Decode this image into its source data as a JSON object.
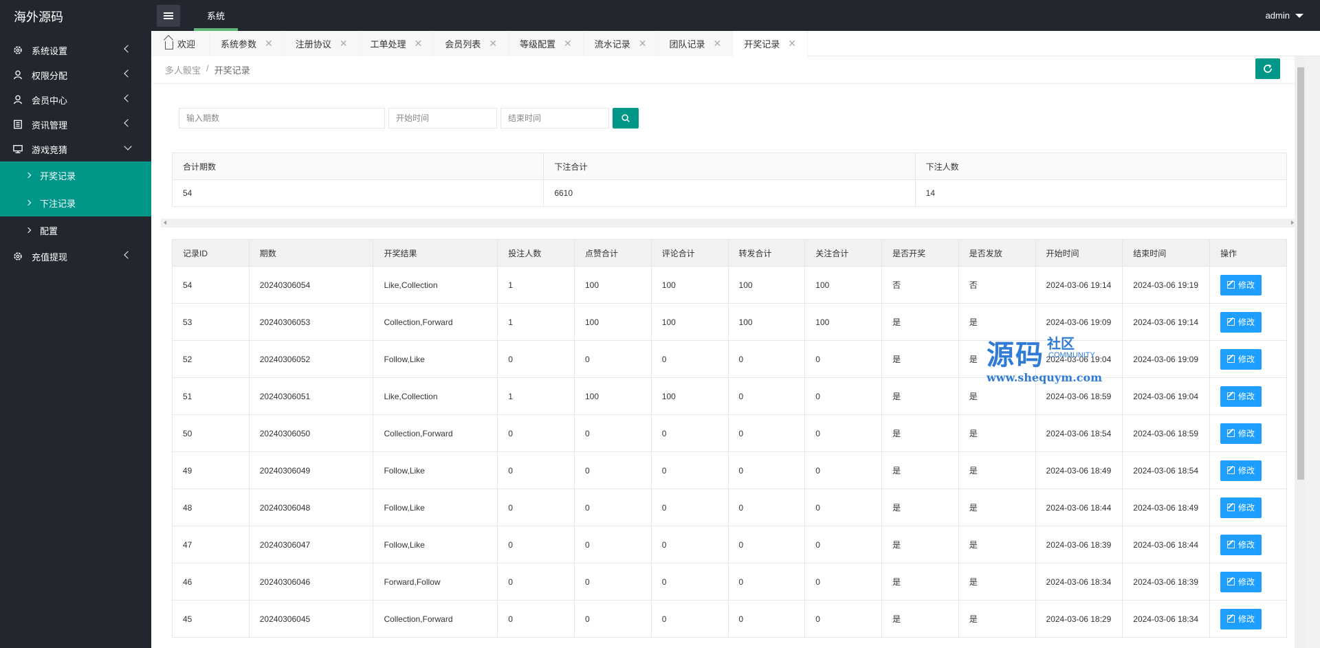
{
  "app": {
    "logo": "海外源码",
    "user": "admin"
  },
  "top_nav": {
    "label": "系统"
  },
  "sidebar": {
    "items": [
      {
        "label": "系统设置",
        "icon": "gear-icon"
      },
      {
        "label": "权限分配",
        "icon": "user-icon"
      },
      {
        "label": "会员中心",
        "icon": "user-icon"
      },
      {
        "label": "资讯管理",
        "icon": "document-icon"
      },
      {
        "label": "游戏竞猜",
        "icon": "monitor-icon"
      },
      {
        "label": "充值提现",
        "icon": "gear-icon"
      }
    ],
    "sub_items": [
      "开奖记录",
      "下注记录",
      "配置"
    ]
  },
  "tabs": [
    "欢迎",
    "系统参数",
    "注册协议",
    "工单处理",
    "会员列表",
    "等级配置",
    "流水记录",
    "团队记录",
    "开奖记录"
  ],
  "breadcrumb": {
    "root": "多人骰宝",
    "sep": "/",
    "current": "开奖记录"
  },
  "search": {
    "period_placeholder": "输入期数",
    "start_placeholder": "开始时间",
    "end_placeholder": "结束时间"
  },
  "summary": {
    "headers": [
      "合计期数",
      "下注合计",
      "下注人数"
    ],
    "values": [
      "54",
      "6610",
      "14"
    ]
  },
  "records": {
    "headers": [
      "记录ID",
      "期数",
      "开奖结果",
      "投注人数",
      "点赞合计",
      "评论合计",
      "转发合计",
      "关注合计",
      "是否开奖",
      "是否发放",
      "开始时间",
      "结束时间",
      "操作"
    ],
    "edit_label": "修改",
    "rows": [
      [
        "54",
        "20240306054",
        "Like,Collection",
        "1",
        "100",
        "100",
        "100",
        "100",
        "否",
        "否",
        "2024-03-06 19:14",
        "2024-03-06 19:19"
      ],
      [
        "53",
        "20240306053",
        "Collection,Forward",
        "1",
        "100",
        "100",
        "100",
        "100",
        "是",
        "是",
        "2024-03-06 19:09",
        "2024-03-06 19:14"
      ],
      [
        "52",
        "20240306052",
        "Follow,Like",
        "0",
        "0",
        "0",
        "0",
        "0",
        "是",
        "是",
        "2024-03-06 19:04",
        "2024-03-06 19:09"
      ],
      [
        "51",
        "20240306051",
        "Like,Collection",
        "1",
        "100",
        "100",
        "0",
        "0",
        "是",
        "是",
        "2024-03-06 18:59",
        "2024-03-06 19:04"
      ],
      [
        "50",
        "20240306050",
        "Collection,Forward",
        "0",
        "0",
        "0",
        "0",
        "0",
        "是",
        "是",
        "2024-03-06 18:54",
        "2024-03-06 18:59"
      ],
      [
        "49",
        "20240306049",
        "Follow,Like",
        "0",
        "0",
        "0",
        "0",
        "0",
        "是",
        "是",
        "2024-03-06 18:49",
        "2024-03-06 18:54"
      ],
      [
        "48",
        "20240306048",
        "Follow,Like",
        "0",
        "0",
        "0",
        "0",
        "0",
        "是",
        "是",
        "2024-03-06 18:44",
        "2024-03-06 18:49"
      ],
      [
        "47",
        "20240306047",
        "Follow,Like",
        "0",
        "0",
        "0",
        "0",
        "0",
        "是",
        "是",
        "2024-03-06 18:39",
        "2024-03-06 18:44"
      ],
      [
        "46",
        "20240306046",
        "Forward,Follow",
        "0",
        "0",
        "0",
        "0",
        "0",
        "是",
        "是",
        "2024-03-06 18:34",
        "2024-03-06 18:39"
      ],
      [
        "45",
        "20240306045",
        "Collection,Forward",
        "0",
        "0",
        "0",
        "0",
        "0",
        "是",
        "是",
        "2024-03-06 18:29",
        "2024-03-06 18:34"
      ]
    ]
  },
  "watermark": {
    "big": "源码",
    "cn": "社区",
    "en": "COMMUNITY",
    "url": "www.shequym.com"
  },
  "colors": {
    "header": "#23262e",
    "accent": "#009688",
    "edit": "#1e9fff",
    "nav_underline": "#5fb878"
  }
}
